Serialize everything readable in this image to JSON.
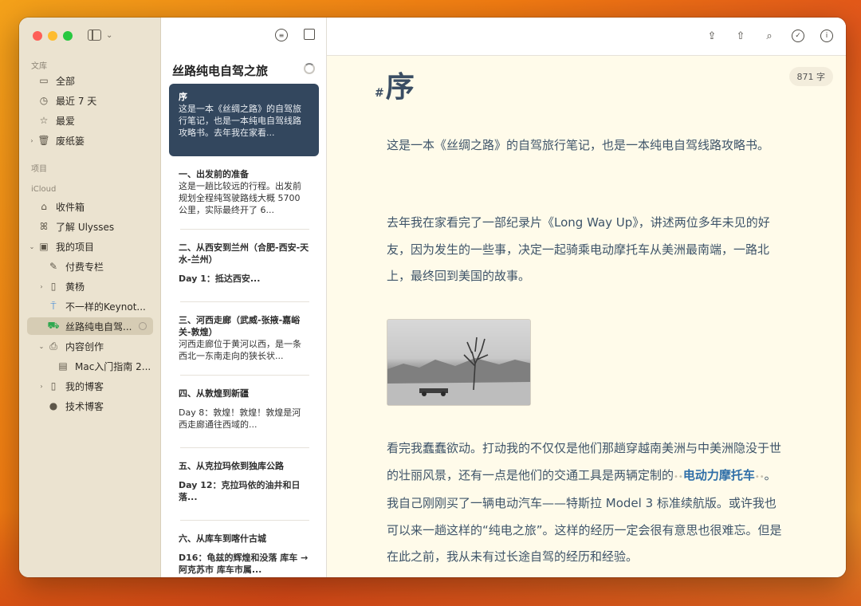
{
  "sidebar": {
    "section_library": "文库",
    "section_projects": "项目",
    "section_icloud": "iCloud",
    "library_items": [
      {
        "label": "全部",
        "icon": "tray-icon"
      },
      {
        "label": "最近 7 天",
        "icon": "clock-icon"
      },
      {
        "label": "最爱",
        "icon": "star-icon"
      },
      {
        "label": "废纸篓",
        "icon": "trash-icon"
      }
    ],
    "icloud_items": [
      {
        "label": "收件箱",
        "icon": "inbox-icon"
      },
      {
        "label": "了解 Ulysses",
        "icon": "butterfly-icon"
      },
      {
        "label": "我的项目",
        "icon": "folder-icon"
      },
      {
        "label": "付费专栏",
        "icon": "pen-icon"
      },
      {
        "label": "黄杨",
        "icon": "book-icon"
      },
      {
        "label": "不一样的Keynot...",
        "icon": "keynote-icon"
      },
      {
        "label": "丝路纯电自驾...",
        "icon": "car-icon"
      },
      {
        "label": "内容创作",
        "icon": "printer-icon"
      },
      {
        "label": "Mac入门指南 2...",
        "icon": "document-icon"
      },
      {
        "label": "我的博客",
        "icon": "book-icon"
      },
      {
        "label": "技术博客",
        "icon": "github-icon"
      }
    ]
  },
  "sheet_list": {
    "group_title": "丝路纯电自驾之旅",
    "sheets": [
      {
        "title": "序",
        "body": "这是一本《丝绸之路》的自驾旅行笔记，也是一本纯电自驾线路攻略书。去年我在家看..."
      },
      {
        "title": "一、出发前的准备",
        "body": "这是一趟比较远的行程。出发前规划全程纯驾驶路线大概 5700 公里，实际最终开了 6..."
      },
      {
        "title": "二、从西安到兰州（合肥-西安-天水-兰州）",
        "body": "Day 1：抵达西安..."
      },
      {
        "title": "三、河西走廊（武威-张掖-嘉峪关-敦煌）",
        "body": "河西走廊位于黄河以西，是一条西北一东南走向的狭长状..."
      },
      {
        "title": "四、从敦煌到新疆",
        "body": "Day 8：敦煌！敦煌！敦煌是河西走廊通往西域的..."
      },
      {
        "title": "五、从克拉玛依到独库公路",
        "body": "Day 12：克拉玛依的油井和日落..."
      },
      {
        "title": "六、从库车到喀什古城",
        "body": "D16：龟兹的辉煌和没落 库车 → 阿克苏市 库车市属..."
      }
    ]
  },
  "editor": {
    "word_count": "871 字",
    "heading_mark": "#",
    "heading": "序",
    "para1": "这是一本《丝绸之路》的自驾旅行笔记，也是一本纯电自驾线路攻略书。",
    "para2": "去年我在家看完了一部纪录片《Long Way Up》，讲述两位多年未见的好友，因为发生的一些事，决定一起骑乘电动摩托车从美洲最南端，一路北上，最终回到美国的故事。",
    "para3_a": "看完我蠢蠢欲动。打动我的不仅仅是他们那趟穿越南美洲与中美洲隐没于世的壮丽风景，还有一点是他们的交通工具是两辆定制的",
    "para3_link": "电动力摩托车",
    "para3_b": "。我自己刚刚买了一辆电动汽车——特斯拉 Model 3 标准续航版。或许我也可以来一趟这样的“纯电之旅”。这样的经历一定会很有意思也很难忘。但是在此之前，我从未有过长途自驾的经历和经验。",
    "link_marker": "••"
  }
}
